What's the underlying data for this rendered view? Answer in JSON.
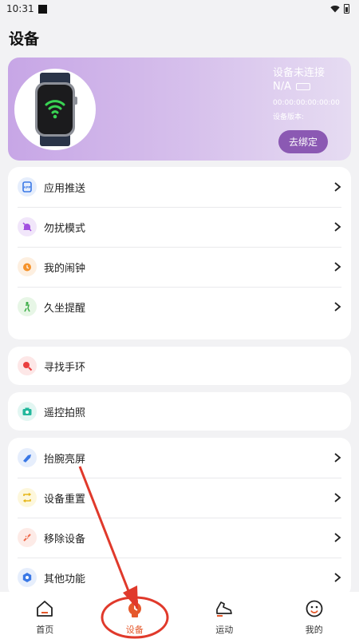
{
  "status_bar": {
    "time": "10:31"
  },
  "page": {
    "title": "设备"
  },
  "device": {
    "status": "设备未连接",
    "battery": "N/A",
    "mac": "00:00:00:00:00:00",
    "version_label": "设备版本:",
    "bind_button": "去绑定",
    "watch_icon": "smartwatch-wifi-icon"
  },
  "groups": [
    {
      "items": [
        {
          "label": "应用推送",
          "icon": "app-push-icon",
          "icon_bg": "#e6eefc",
          "icon_color": "#3a78e6",
          "chevron": true
        },
        {
          "label": "勿扰模式",
          "icon": "do-not-disturb-icon",
          "icon_bg": "#f1e6fa",
          "icon_color": "#a24fe0",
          "chevron": true
        },
        {
          "label": "我的闹钟",
          "icon": "alarm-clock-icon",
          "icon_bg": "#fdefe0",
          "icon_color": "#f5922a",
          "chevron": true
        },
        {
          "label": "久坐提醒",
          "icon": "sedentary-reminder-icon",
          "icon_bg": "#e7f6e6",
          "icon_color": "#3fae4a",
          "chevron": true
        }
      ]
    },
    {
      "items": [
        {
          "label": "寻找手环",
          "icon": "find-band-icon",
          "icon_bg": "#fde7e7",
          "icon_color": "#ea3e3e",
          "chevron": false
        }
      ]
    },
    {
      "items": [
        {
          "label": "遥控拍照",
          "icon": "remote-camera-icon",
          "icon_bg": "#e2f6f2",
          "icon_color": "#22b89c",
          "chevron": false
        }
      ]
    },
    {
      "items": [
        {
          "label": "抬腕亮屏",
          "icon": "raise-wrist-icon",
          "icon_bg": "#e6eefc",
          "icon_color": "#3a78e6",
          "chevron": true
        },
        {
          "label": "设备重置",
          "icon": "device-reset-icon",
          "icon_bg": "#fdf7dc",
          "icon_color": "#e6b71b",
          "chevron": true
        },
        {
          "label": "移除设备",
          "icon": "remove-device-icon",
          "icon_bg": "#fdebe7",
          "icon_color": "#ef6a4c",
          "chevron": true
        },
        {
          "label": "其他功能",
          "icon": "other-functions-icon",
          "icon_bg": "#e6eefc",
          "icon_color": "#3a78e6",
          "chevron": true
        }
      ]
    }
  ],
  "nav": [
    {
      "label": "首页",
      "icon": "home-icon",
      "active": false
    },
    {
      "label": "设备",
      "icon": "device-icon",
      "active": true
    },
    {
      "label": "运动",
      "icon": "sport-shoe-icon",
      "active": false
    },
    {
      "label": "我的",
      "icon": "profile-smiley-icon",
      "active": false
    }
  ],
  "colors": {
    "accent": "#e5582b",
    "annotation_red": "#e0392b",
    "card_gradient_start": "#c7a6e6",
    "card_gradient_end": "#e6dcf2",
    "bind_button": "#8b59b3"
  }
}
